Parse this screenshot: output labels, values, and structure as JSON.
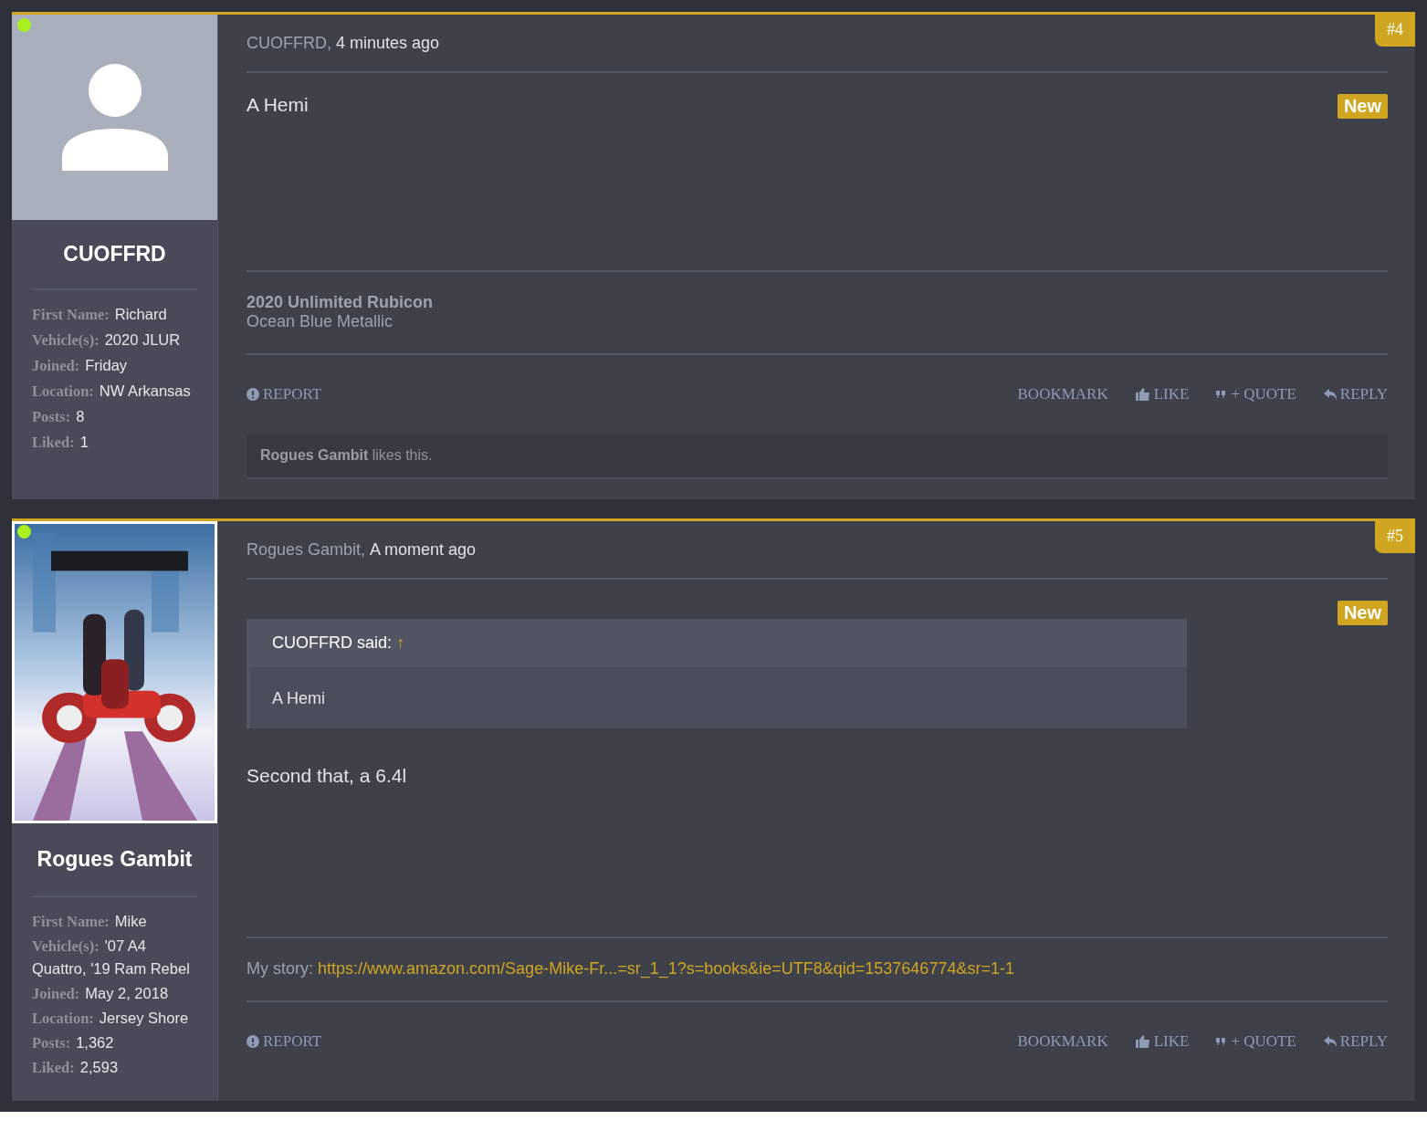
{
  "posts": [
    {
      "number": "#4",
      "author": "CUOFFRD,",
      "time": "4 minutes ago",
      "online": true,
      "avatar": {
        "kind": "silhouette"
      },
      "username": "CUOFFRD",
      "fields": [
        {
          "label": "First Name:",
          "value": "Richard"
        },
        {
          "label": "Vehicle(s):",
          "value": "2020 JLUR"
        },
        {
          "label": "Joined:",
          "value": "Friday"
        },
        {
          "label": "Location:",
          "value": "NW Arkansas"
        },
        {
          "label": "Posts:",
          "value": "8"
        },
        {
          "label": "Liked:",
          "value": "1"
        }
      ],
      "new_badge": "New",
      "message": "A Hemi",
      "signature": [
        {
          "kind": "title",
          "text": "2020 Unlimited Rubicon"
        },
        {
          "kind": "text",
          "text": "Ocean Blue Metallic"
        }
      ],
      "actions": {
        "report": "REPORT",
        "bookmark": "BOOKMARK",
        "like": "LIKE",
        "quote": "+ QUOTE",
        "reply": "REPLY"
      },
      "likes": {
        "who": "Rogues Gambit",
        "text": "likes this."
      }
    },
    {
      "number": "#5",
      "author": "Rogues Gambit,",
      "time": "A moment ago",
      "online": true,
      "avatar": {
        "kind": "picture"
      },
      "username": "Rogues Gambit",
      "fields": [
        {
          "label": "First Name:",
          "value": "Mike"
        },
        {
          "label": "Vehicle(s):",
          "value": "'07 A4 Quattro, '19 Ram Rebel"
        },
        {
          "label": "Joined:",
          "value": "May 2, 2018"
        },
        {
          "label": "Location:",
          "value": "Jersey Shore"
        },
        {
          "label": "Posts:",
          "value": "1,362"
        },
        {
          "label": "Liked:",
          "value": "2,593"
        }
      ],
      "new_badge": "New",
      "quote": {
        "author": "CUOFFRD said:",
        "arrow": "↑",
        "text": "A Hemi"
      },
      "message": "Second that, a 6.4l",
      "signature": [
        {
          "kind": "link",
          "label": "My story:",
          "text": "https://www.amazon.com/Sage-Mike-Fr...=sr_1_1?s=books&ie=UTF8&qid=1537646774&sr=1-1"
        }
      ],
      "actions": {
        "report": "REPORT",
        "bookmark": "BOOKMARK",
        "like": "LIKE",
        "quote": "+ QUOTE",
        "reply": "REPLY"
      }
    }
  ]
}
